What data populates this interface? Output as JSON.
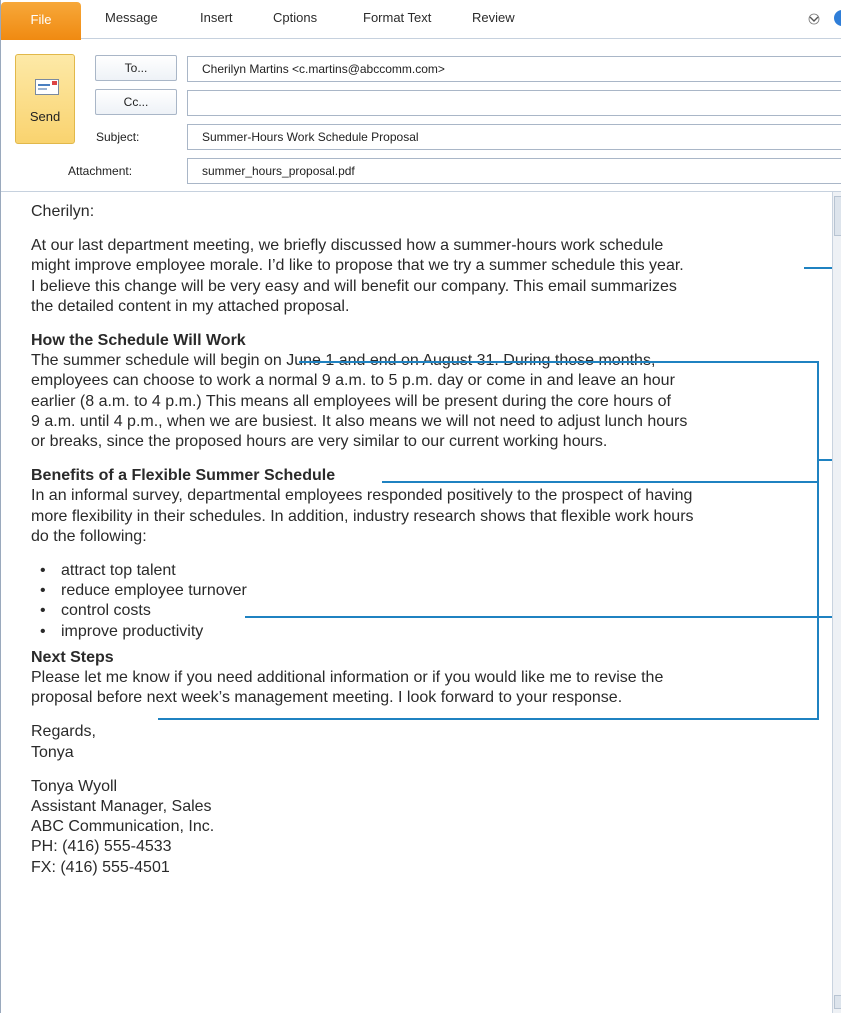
{
  "ribbon": {
    "tabs": [
      "File",
      "Message",
      "Insert",
      "Cptions",
      "Format Text",
      "Review"
    ]
  },
  "header": {
    "send_label": "Send",
    "to_button": "To...",
    "cc_button": "Cc...",
    "subject_label": "Subject:",
    "attachment_label": "Attachment:",
    "to_value": "Cherilyn Martins <c.martins@abccomm.com>",
    "cc_value": "",
    "subject_value": "Summer-Hours Work Schedule Proposal",
    "attachment_value": "summer_hours_proposal.pdf"
  },
  "body": {
    "greeting": "Cherilyn:",
    "intro": [
      "At our last department meeting, we briefly discussed how a summer-hours work schedule",
      "might improve employee morale. I’d like to propose that we try a summer schedule this year.",
      "I believe this change will be very easy and will benefit our company. This email summarizes",
      "the detailed content in my attached proposal."
    ],
    "section1_heading": "How the Schedule Will Work",
    "section1": [
      "The summer schedule will begin on June 1 and end on August 31. During those months,",
      "employees can choose to work a normal 9 a.m. to 5 p.m. day or come in and leave an hour",
      "earlier (8 a.m. to 4 p.m.)  This means all employees will be present during the core hours of",
      "9 a.m. until 4 p.m., when we are busiest. It also means we will not need to adjust lunch hours",
      "or breaks, since the proposed hours are very similar to our current working hours."
    ],
    "section2_heading": "Benefits of a Flexible Summer Schedule",
    "section2": [
      "In an informal survey, departmental employees responded positively to the prospect of having",
      "more  flexibility in their schedules. In addition, industry research shows that flexible work hours",
      "do the following:"
    ],
    "bullets": [
      "attract top talent",
      "reduce employee turnover",
      "control costs",
      "improve productivity"
    ],
    "section3_heading": "Next Steps",
    "section3": [
      "Please let me know if you need additional information or if you would like me to revise the",
      "proposal before next week’s management meeting. I look forward to your response."
    ],
    "closing": [
      "Regards,",
      "Tonya"
    ],
    "signature": [
      "Tonya Wyoll",
      "Assistant Manager, Sales",
      "ABC Communication, Inc.",
      "PH: (416) 555-4533",
      "FX: (416) 555-4501"
    ]
  },
  "colors": {
    "file_tab": "#f08a11",
    "callout_line": "#1f82c1",
    "send_button": "#f9d36f"
  }
}
